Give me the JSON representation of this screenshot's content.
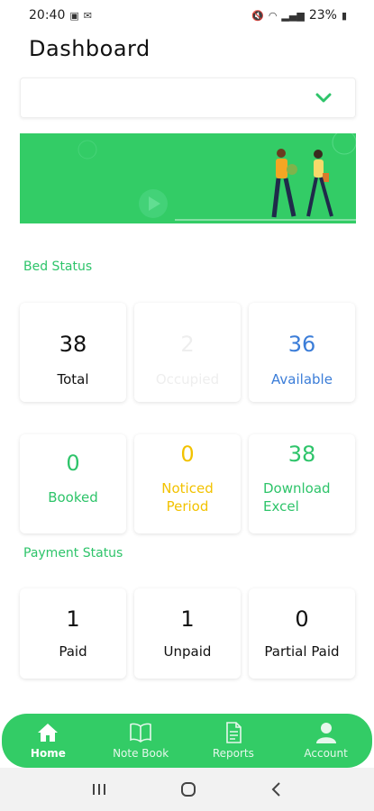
{
  "status_bar": {
    "time": "20:40",
    "battery": "23%"
  },
  "header": {
    "title": "Dashboard"
  },
  "dropdown": {
    "value": ""
  },
  "bed_status": {
    "label": "Bed Status",
    "cards": [
      {
        "value": "38",
        "label": "Total",
        "color": "#111111"
      },
      {
        "value": "2",
        "label": "Occupied",
        "color": "#eeeeee"
      },
      {
        "value": "36",
        "label": "Available",
        "color": "#3b7dd8"
      },
      {
        "value": "0",
        "label": "Booked",
        "color": "#2ec46a"
      },
      {
        "value": "0",
        "label": "Noticed Period",
        "color": "#f2c200"
      },
      {
        "value": "38",
        "label": "Download Excel",
        "color": "#2ec46a"
      }
    ]
  },
  "payment_status": {
    "label": "Payment Status",
    "cards": [
      {
        "value": "1",
        "label": "Paid"
      },
      {
        "value": "1",
        "label": "Unpaid"
      },
      {
        "value": "0",
        "label": "Partial Paid"
      }
    ]
  },
  "bottom_nav": {
    "items": [
      {
        "label": "Home",
        "icon": "home-icon",
        "active": true
      },
      {
        "label": "Note Book",
        "icon": "book-icon",
        "active": false
      },
      {
        "label": "Reports",
        "icon": "document-icon",
        "active": false
      },
      {
        "label": "Account",
        "icon": "user-icon",
        "active": false
      }
    ]
  },
  "colors": {
    "accent": "#33cc66",
    "label_green": "#2ec46a",
    "blue": "#3b7dd8",
    "yellow": "#f2c200"
  }
}
